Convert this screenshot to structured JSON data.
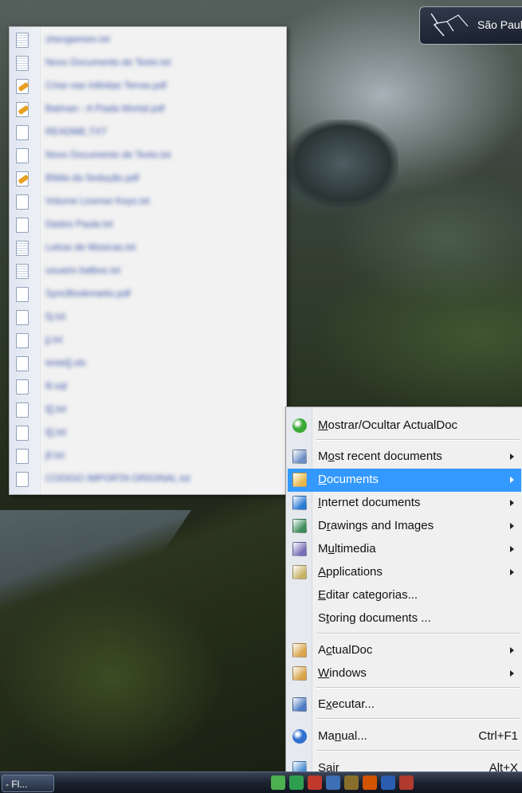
{
  "gadget": {
    "city": "São Paulo",
    "icon": "lightning-weather-icon"
  },
  "taskbar": {
    "button_label": "- Fl..."
  },
  "recent_documents": [
    {
      "label": "zhengwmen.txt",
      "type": "txt"
    },
    {
      "label": "Novo Documento de Texto.txt",
      "type": "txt"
    },
    {
      "label": "Crise nas Infinitas Terras.pdf",
      "type": "pdf"
    },
    {
      "label": "Batman - A Piada Mortal.pdf",
      "type": "pdf"
    },
    {
      "label": "README.TXT",
      "type": "doc"
    },
    {
      "label": "Novo Documento de Texto.txt",
      "type": "doc"
    },
    {
      "label": "Bíblia da Sedução.pdf",
      "type": "pdf"
    },
    {
      "label": "Volume License Keys.txt",
      "type": "doc"
    },
    {
      "label": "Dados Paula.txt",
      "type": "doc"
    },
    {
      "label": "Letras de Músicas.txt",
      "type": "txt"
    },
    {
      "label": "usuario balbos.txt",
      "type": "txt"
    },
    {
      "label": "SyncBookmarks.pdf",
      "type": "doc"
    },
    {
      "label": "5j.txt",
      "type": "doc"
    },
    {
      "label": "jj.txt",
      "type": "doc"
    },
    {
      "label": "teste[].xls",
      "type": "doc"
    },
    {
      "label": "lll.sql",
      "type": "doc"
    },
    {
      "label": "t[].txt",
      "type": "doc"
    },
    {
      "label": "t[].txt",
      "type": "doc"
    },
    {
      "label": "jll.txt",
      "type": "doc"
    },
    {
      "label": "CODIGO IMPORTA ORIGINAL.txt",
      "type": "doc"
    }
  ],
  "menu": {
    "items": [
      {
        "label": "Mostrar/Ocultar ActualDoc",
        "accel_index": 0,
        "icon": "green-arrow-down-icon",
        "submenu": false,
        "shortcut": "",
        "selected": false
      },
      {
        "label": "Most recent documents",
        "accel_index": 1,
        "icon": "clock-icon",
        "submenu": true,
        "shortcut": "",
        "selected": false
      },
      {
        "label": "Documents",
        "accel_index": 0,
        "icon": "folder-documents-icon",
        "submenu": true,
        "shortcut": "",
        "selected": true
      },
      {
        "label": "Internet documents",
        "accel_index": 0,
        "icon": "internet-explorer-icon",
        "submenu": true,
        "shortcut": "",
        "selected": false
      },
      {
        "label": "Drawings and Images",
        "accel_index": 1,
        "icon": "image-icon",
        "submenu": true,
        "shortcut": "",
        "selected": false
      },
      {
        "label": "Multimedia",
        "accel_index": 1,
        "icon": "multimedia-icon",
        "submenu": true,
        "shortcut": "",
        "selected": false
      },
      {
        "label": "Applications",
        "accel_index": 0,
        "icon": "applications-icon",
        "submenu": true,
        "shortcut": "",
        "selected": false
      },
      {
        "label": "Editar categorias...",
        "accel_index": 0,
        "icon": "",
        "submenu": false,
        "shortcut": "",
        "selected": false
      },
      {
        "label": "Storing documents ...",
        "accel_index": 1,
        "icon": "",
        "submenu": false,
        "shortcut": "",
        "selected": false
      },
      {
        "label": "ActualDoc",
        "accel_index": 1,
        "icon": "actualdoc-icon",
        "submenu": true,
        "shortcut": "",
        "selected": false
      },
      {
        "label": "Windows",
        "accel_index": 0,
        "icon": "windows-icon",
        "submenu": true,
        "shortcut": "",
        "selected": false
      },
      {
        "label": "Executar...",
        "accel_index": 1,
        "icon": "run-icon",
        "submenu": false,
        "shortcut": "",
        "selected": false
      },
      {
        "label": "Manual...",
        "accel_index": 2,
        "icon": "help-icon",
        "submenu": false,
        "shortcut": "Ctrl+F1",
        "selected": false
      },
      {
        "label": "Sair",
        "accel_index": 0,
        "icon": "exit-icon",
        "submenu": false,
        "shortcut": "Alt+X",
        "selected": false
      }
    ]
  },
  "colors": {
    "menu_selection": "#3399ff",
    "doc_label": "#3a55a8"
  }
}
